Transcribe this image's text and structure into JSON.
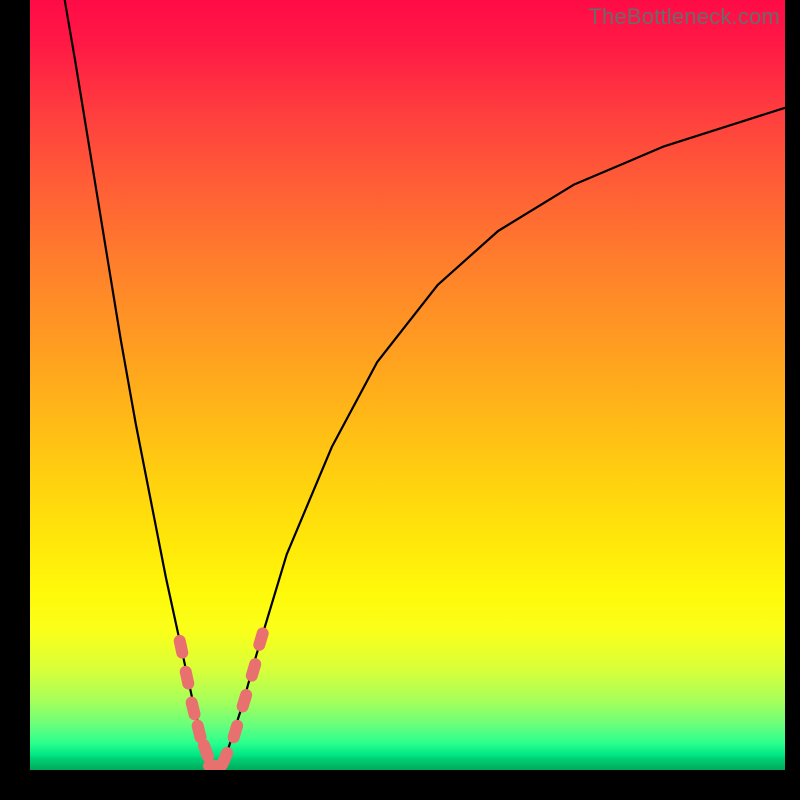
{
  "watermark": "TheBottleneck.com",
  "colors": {
    "curve_stroke": "#000000",
    "marker_fill": "#e8706f",
    "background_black": "#000000"
  },
  "chart_data": {
    "type": "line",
    "title": "",
    "xlabel": "",
    "ylabel": "",
    "xlim": [
      0,
      100
    ],
    "ylim": [
      0,
      100
    ],
    "grid": false,
    "legend": false,
    "note": "V-shaped bottleneck curve. Minimum near x≈24 (y≈0). Axis ticks not shown; values estimated from curve shape.",
    "curve": [
      {
        "x": 4.6,
        "y": 100
      },
      {
        "x": 6.0,
        "y": 92
      },
      {
        "x": 8.0,
        "y": 80
      },
      {
        "x": 10.0,
        "y": 68
      },
      {
        "x": 12.0,
        "y": 56
      },
      {
        "x": 14.0,
        "y": 45
      },
      {
        "x": 16.0,
        "y": 35
      },
      {
        "x": 18.0,
        "y": 25
      },
      {
        "x": 20.0,
        "y": 16
      },
      {
        "x": 22.0,
        "y": 7
      },
      {
        "x": 23.5,
        "y": 2
      },
      {
        "x": 24.5,
        "y": 0
      },
      {
        "x": 26.0,
        "y": 2
      },
      {
        "x": 28.0,
        "y": 8
      },
      {
        "x": 30.0,
        "y": 15
      },
      {
        "x": 34.0,
        "y": 28
      },
      {
        "x": 40.0,
        "y": 42
      },
      {
        "x": 46.0,
        "y": 53
      },
      {
        "x": 54.0,
        "y": 63
      },
      {
        "x": 62.0,
        "y": 70
      },
      {
        "x": 72.0,
        "y": 76
      },
      {
        "x": 84.0,
        "y": 81
      },
      {
        "x": 100.0,
        "y": 86
      }
    ],
    "markers": [
      {
        "x": 20.0,
        "y": 16
      },
      {
        "x": 20.8,
        "y": 12
      },
      {
        "x": 21.6,
        "y": 8
      },
      {
        "x": 22.4,
        "y": 5
      },
      {
        "x": 23.3,
        "y": 2.5
      },
      {
        "x": 24.5,
        "y": 0.5
      },
      {
        "x": 25.8,
        "y": 1.5
      },
      {
        "x": 27.2,
        "y": 5
      },
      {
        "x": 28.4,
        "y": 9
      },
      {
        "x": 29.6,
        "y": 13
      },
      {
        "x": 30.6,
        "y": 17
      }
    ]
  }
}
